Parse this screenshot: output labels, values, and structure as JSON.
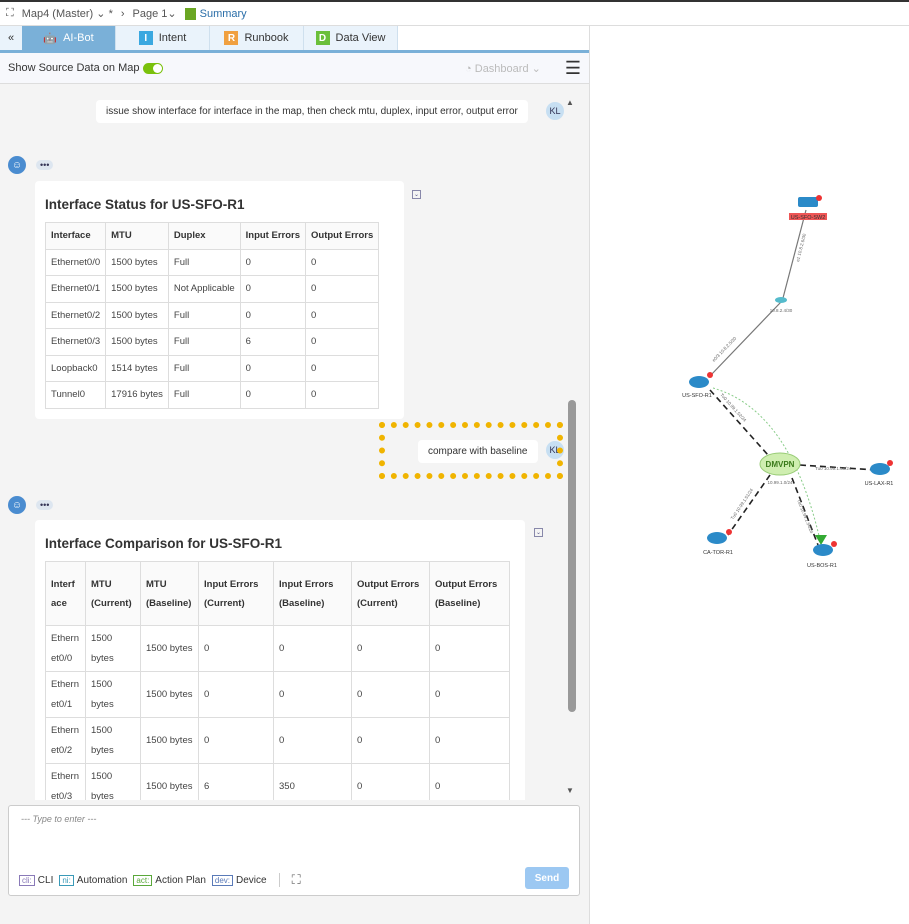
{
  "topbar": {
    "map": "Map4 (Master)",
    "modified": "*",
    "page": "Page 1",
    "summary": "Summary"
  },
  "tabs": [
    {
      "label": "AI-Bot",
      "letter": "",
      "color": "#7ab0d8"
    },
    {
      "label": "Intent",
      "letter": "I",
      "color": "#3aa8e0"
    },
    {
      "label": "Runbook",
      "letter": "R",
      "color": "#f0a040"
    },
    {
      "label": "Data View",
      "letter": "D",
      "color": "#6abf3a"
    }
  ],
  "toolbar": {
    "show_source": "Show Source Data on Map",
    "show_source_on": true,
    "dashboard": "Dashboard"
  },
  "chat": {
    "user_initials": "KL",
    "msg1": "issue show interface for interface in the map, then check mtu, duplex, input error, output error",
    "dots": "•••",
    "table1": {
      "title": "Interface Status for US-SFO-R1",
      "headers": [
        "Interface",
        "MTU",
        "Duplex",
        "Input Errors",
        "Output Errors"
      ],
      "rows": [
        [
          "Ethernet0/0",
          "1500 bytes",
          "Full",
          "0",
          "0"
        ],
        [
          "Ethernet0/1",
          "1500 bytes",
          "Not Applicable",
          "0",
          "0"
        ],
        [
          "Ethernet0/2",
          "1500 bytes",
          "Full",
          "0",
          "0"
        ],
        [
          "Ethernet0/3",
          "1500 bytes",
          "Full",
          "6",
          "0"
        ],
        [
          "Loopback0",
          "1514 bytes",
          "Full",
          "0",
          "0"
        ],
        [
          "Tunnel0",
          "17916 bytes",
          "Full",
          "0",
          "0"
        ]
      ]
    },
    "msg2": "compare with baseline",
    "table2": {
      "title": "Interface Comparison for US-SFO-R1",
      "headers": [
        "Interface",
        "MTU (Current)",
        "MTU (Baseline)",
        "Input Errors (Current)",
        "Input Errors (Baseline)",
        "Output Errors (Current)",
        "Output Errors (Baseline)"
      ],
      "rows": [
        [
          "Ethernet0/0",
          "1500 bytes",
          "1500 bytes",
          "0",
          "0",
          "0",
          "0"
        ],
        [
          "Ethernet0/1",
          "1500 bytes",
          "1500 bytes",
          "0",
          "0",
          "0",
          "0"
        ],
        [
          "Ethernet0/2",
          "1500 bytes",
          "1500 bytes",
          "0",
          "0",
          "0",
          "0"
        ],
        [
          "Ethernet0/3",
          "1500 bytes",
          "1500 bytes",
          "6",
          "350",
          "0",
          "0"
        ]
      ]
    }
  },
  "input": {
    "placeholder": "--- Type to enter ---",
    "chips": [
      {
        "tag": "cli:",
        "label": "CLI",
        "color": "#8a7ab8"
      },
      {
        "tag": "ni:",
        "label": "Automation",
        "color": "#3a9ab8"
      },
      {
        "tag": "act:",
        "label": "Action Plan",
        "color": "#5aa83a"
      },
      {
        "tag": "dev:",
        "label": "Device",
        "color": "#5a7ab8"
      }
    ],
    "send": "Send"
  },
  "map": {
    "devices": [
      "US-SFO-SW2",
      "US-SFO-R1",
      "US-LAX-R1",
      "CA-TOR-R1",
      "US-BOS-R1"
    ],
    "cloud": "DMVPN",
    "labels": {
      "sw2_link": "e1 10.8.2.6/30",
      "subnet1": "10.8.2.4/30",
      "r1_link": "e0/3 10.8.2.5/30",
      "r1_tu": "Tu0 10.99.1.52/24",
      "lax_tu": "Tu0 10.99.1.53/24",
      "cloud_subnet": "10.99.1.0/24",
      "tor_tu": "Tu0 10.99.1.51/24",
      "bos_tu": "Tu0 10.99.1.54/24"
    }
  }
}
